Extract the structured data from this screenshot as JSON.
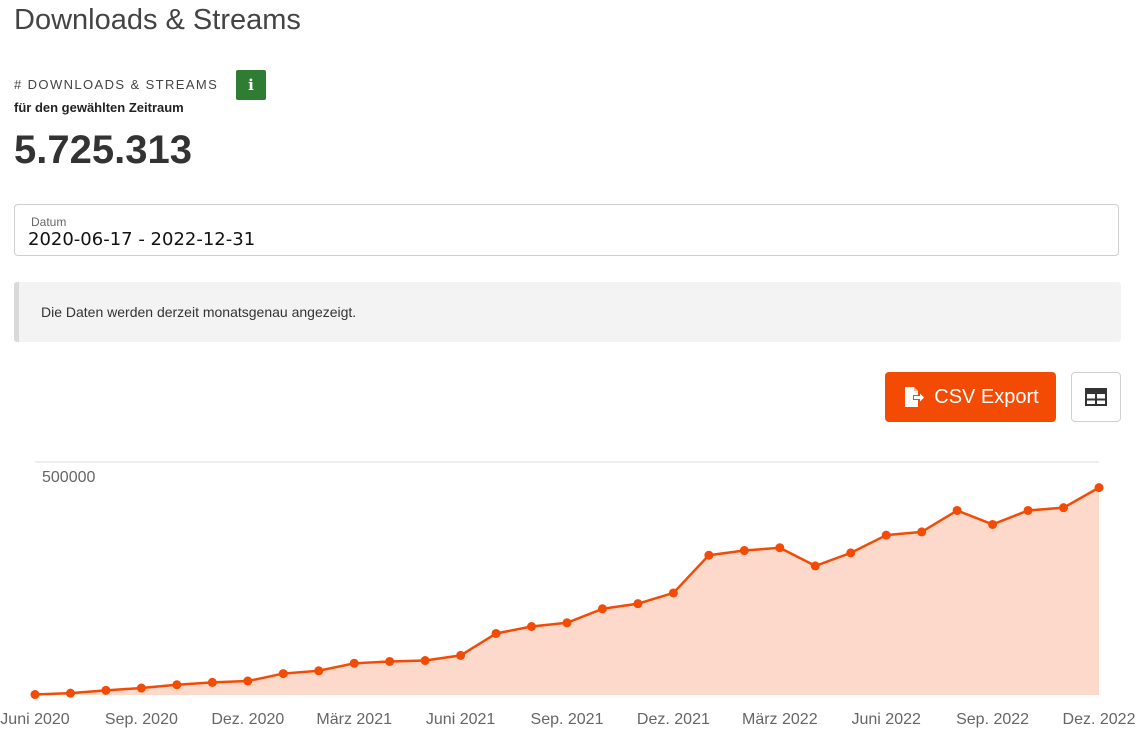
{
  "page": {
    "title": "Downloads & Streams"
  },
  "kpi": {
    "label": "# DOWNLOADS & STREAMS",
    "sublabel": "für den gewählten Zeitraum",
    "value": "5.725.313"
  },
  "date_filter": {
    "label": "Datum",
    "value": "2020-06-17 - 2022-12-31"
  },
  "notice": {
    "text": "Die Daten werden derzeit monatsgenau angezeigt."
  },
  "toolbar": {
    "csv_label": "CSV Export",
    "info_icon": "info-icon",
    "table_icon": "table-icon"
  },
  "colors": {
    "accent": "#f44b04",
    "area_fill": "#fdd9cc",
    "info_green": "#2e7d32"
  },
  "chart_data": {
    "type": "area",
    "x_tick_labels": [
      "Juni 2020",
      "Sep. 2020",
      "Dez. 2020",
      "März 2021",
      "Juni 2021",
      "Sep. 2021",
      "Dez. 2021",
      "März 2022",
      "Juni 2022",
      "Sep. 2022",
      "Dez. 2022"
    ],
    "y_tick_labels": [
      "500000"
    ],
    "y_ticks": [
      500000
    ],
    "ylim": [
      0,
      500000
    ],
    "series": [
      {
        "x": [
          "2020-06",
          "2020-07",
          "2020-08",
          "2020-09",
          "2020-10",
          "2020-11",
          "2020-12",
          "2021-01",
          "2021-02",
          "2021-03",
          "2021-04",
          "2021-05",
          "2021-06",
          "2021-07",
          "2021-08",
          "2021-09",
          "2021-10",
          "2021-11",
          "2021-12",
          "2022-01",
          "2022-02",
          "2022-03",
          "2022-04",
          "2022-05",
          "2022-06",
          "2022-07",
          "2022-08",
          "2022-09",
          "2022-10",
          "2022-11",
          "2022-12"
        ],
        "values": [
          1000,
          4000,
          10000,
          15000,
          22000,
          27000,
          30000,
          46000,
          52000,
          68000,
          72000,
          74000,
          85000,
          132000,
          147000,
          155000,
          185000,
          196000,
          219000,
          300000,
          310000,
          316000,
          277000,
          305000,
          343000,
          350000,
          396000,
          366000,
          396000,
          402000,
          445000
        ]
      }
    ],
    "grid": true,
    "legend": "none"
  }
}
